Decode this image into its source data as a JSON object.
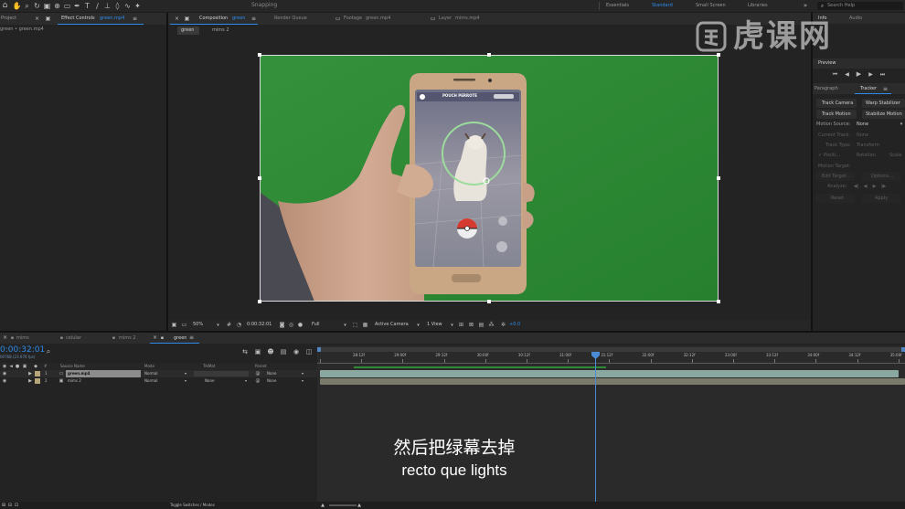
{
  "toolbar": {
    "snapping": "Snapping",
    "workspaces": [
      "Essentials",
      "Standard",
      "Small Screen",
      "Libraries"
    ],
    "search_placeholder": "Search Help",
    "tools": [
      "hand-tool-icon",
      "zoom-tool-icon",
      "rotate-tool-icon",
      "camera-tool-icon",
      "pan-behind-tool-icon",
      "rectangle-tool-icon",
      "pen-tool-icon",
      "type-tool-icon",
      "brush-tool-icon",
      "clone-stamp-tool-icon",
      "eraser-tool-icon",
      "roto-brush-tool-icon",
      "puppet-tool-icon"
    ]
  },
  "left_panel": {
    "tab_project": "Project",
    "tab_effect_controls": "Effect Controls",
    "effect_layer": "green.mp4",
    "breadcrumb": "green • green.mp4"
  },
  "viewer": {
    "tabs": [
      {
        "label": "Composition",
        "name": "green",
        "active": true
      },
      {
        "label": "Render Queue",
        "name": "",
        "active": false
      },
      {
        "label": "Footage",
        "name": "green.mp4",
        "active": false
      },
      {
        "label": "Layer",
        "name": "mims.mp4",
        "active": false
      }
    ],
    "flow": [
      "green",
      "mims 2"
    ],
    "phone_app_text": "POUCH PERROTE",
    "footer": {
      "zoom": "50%",
      "timecode": "0:00:32:01",
      "resolution": "Full",
      "camera": "Active Camera",
      "views": "1 View",
      "exposure": "+0.0"
    }
  },
  "right_panel": {
    "tabs_top": [
      "Info",
      "Audio"
    ],
    "preview_title": "Preview",
    "tabs": [
      "Paragraph",
      "Tracker"
    ],
    "buttons_row1": [
      "Track Camera",
      "Warp Stabilizer"
    ],
    "buttons_row2": [
      "Track Motion",
      "Stabilize Motion"
    ],
    "motion_source_label": "Motion Source:",
    "motion_source_value": "None",
    "current_track_label": "Current Track:",
    "current_track_value": "None",
    "track_type_label": "Track Type:",
    "track_type_value": "Transform",
    "checks": [
      "Positi...",
      "Rotation",
      "Scale"
    ],
    "motion_target": "Motion Target:",
    "edit_target": "Edit Target...",
    "options": "Options...",
    "analyze": "Analyze:",
    "reset": "Reset",
    "apply": "Apply"
  },
  "timeline": {
    "tabs": [
      "mims",
      "celular",
      "mims 2",
      "green"
    ],
    "timecode": "0:00:32:01",
    "frame_info": "00768 (23.976 fps)",
    "columns": {
      "source_name": "Source Name",
      "mode": "Mode",
      "trkmat": "TrkMat",
      "parent": "Parent"
    },
    "layers": [
      {
        "num": "1",
        "name": "green.mp4",
        "mode": "Normal",
        "trkmat": "",
        "parent": "None"
      },
      {
        "num": "2",
        "name": "mims 2",
        "mode": "Normal",
        "trkmat": "None",
        "parent": "None"
      }
    ],
    "ruler": [
      "28:12f",
      "29:00f",
      "29:12f",
      "30:00f",
      "30:12f",
      "31:00f",
      "31:12f",
      "32:00f",
      "32:12f",
      "33:00f",
      "33:12f",
      "34:00f",
      "34:12f",
      "35:00f",
      "35:12f"
    ],
    "toggle_label": "Toggle Switches / Modes"
  },
  "subtitles": {
    "chinese": "然后把绿幕去掉",
    "english": "recto que lights"
  },
  "watermark": {
    "text": "虎课网"
  },
  "colors": {
    "accent": "#2d8ceb",
    "green_screen": "#2d8a34",
    "track_bar": "#8aa8a0"
  }
}
